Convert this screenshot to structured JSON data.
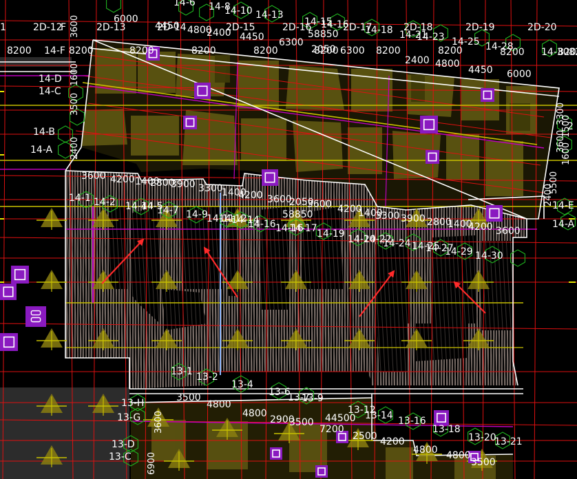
{
  "colors": {
    "background": "#000000",
    "grid_red": "#e01010",
    "outline_white": "#ffffff",
    "hatch": "#c8b4aa",
    "olive_fill": "#5e5612",
    "olive_dark": "#3e3a08",
    "yellow_line": "#c8c000",
    "magenta_line": "#c000c0",
    "green_hex": "#1fb31f",
    "purple_marker": "#8a1ac0",
    "arrow_red": "#ff2a2a",
    "grey_slab": "#2c2c2c",
    "label_white": "#ffffff"
  },
  "icons": {
    "column_marker": "square-column-icon",
    "axis_bubble": "hexagon-axis-icon",
    "direction_arrow": "red-arrow-icon",
    "pile_symbol": "triangle-pile-icon"
  },
  "top_axes": [
    "1",
    "2D-12",
    "F",
    "2D-13",
    "2D-14",
    "2D-15",
    "2D-16",
    "2D-17",
    "2D-18",
    "2D-19",
    "2D-20"
  ],
  "left_axes": [
    "14-F",
    "14-D",
    "14-C",
    "14-B",
    "14-A",
    "13-H",
    "13-G",
    "13-D",
    "13-C"
  ],
  "right_axes": [
    "14-E",
    "14-A",
    "2"
  ],
  "upper_axes": [
    "14-6",
    "14-8",
    "14-10",
    "14-13",
    "14-15",
    "14-16",
    "14-18",
    "14-21",
    "14-23",
    "14-25",
    "14-28",
    "14-30"
  ],
  "middle_axes": [
    "14-1",
    "14-2",
    "14-4",
    "14-5",
    "14-7",
    "14-9",
    "14-11",
    "14-12",
    "14-14",
    "14-16",
    "14-16",
    "14-17",
    "14-19",
    "14-20",
    "14-22",
    "14-24",
    "14-25",
    "14-27",
    "14-29",
    "14-30"
  ],
  "lower_axes": [
    "13-1",
    "13-2",
    "13-4",
    "13-6",
    "13-7",
    "13-9",
    "13-12",
    "13-14",
    "13-16",
    "13-18",
    "13-20",
    "13-21"
  ],
  "dims_top": [
    "6000",
    "4450",
    "4800",
    "2400",
    "4450",
    "58850",
    "6300",
    "2050",
    "6300",
    "2400",
    "4800",
    "4450",
    "6000"
  ],
  "dims_8200": [
    "8200",
    "8200",
    "8200",
    "8200",
    "8200",
    "8200",
    "8200",
    "8200",
    "8200",
    "8200",
    "82"
  ],
  "dims_mid": [
    "3600",
    "4200",
    "1400",
    "2800",
    "3900",
    "3300",
    "1400",
    "4200",
    "3600",
    "2050",
    "3600",
    "4200",
    "1400",
    "3300",
    "3900",
    "2800",
    "1400",
    "4200",
    "3600",
    "58850"
  ],
  "dims_lower": [
    "3500",
    "4800",
    "4800",
    "2900",
    "3500",
    "7200",
    "44500",
    "2500",
    "4200",
    "4800",
    "4800",
    "3500"
  ],
  "dims_left": [
    "3600",
    "1600",
    "3500",
    "2400"
  ],
  "dims_right": [
    "3300",
    "1500",
    "3600",
    "1600",
    "2400",
    "5500"
  ],
  "dims_bottom_left": [
    "3600",
    "6900"
  ]
}
